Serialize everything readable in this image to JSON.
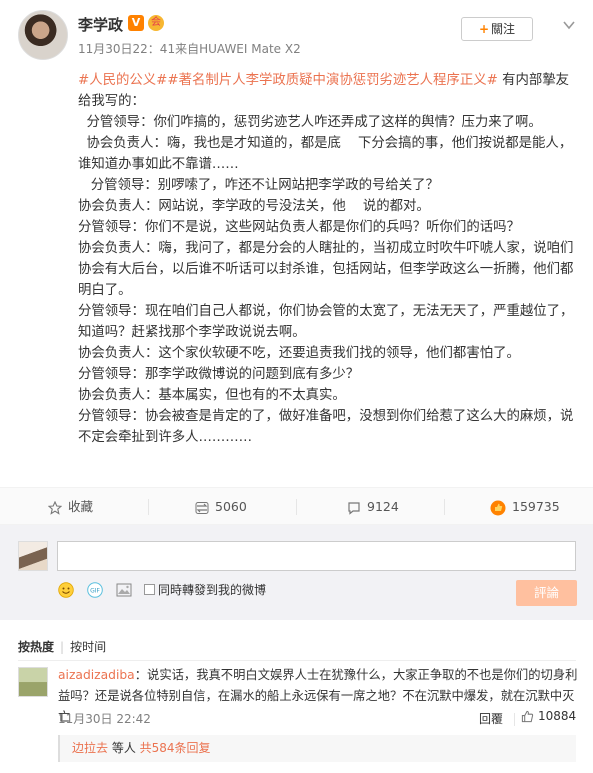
{
  "author": {
    "name": "李学政",
    "verified_badge": "V",
    "member_badge": "会",
    "meta": "11月30日22：41来自HUAWEI Mate X2"
  },
  "follow_button": {
    "plus": "+",
    "label": "關注"
  },
  "post": {
    "topics": [
      "#人民的公义#",
      "#著名制片人李学政质疑中演协惩罚劣迹艺人程序正义#"
    ],
    "intro": " 有内部摯友给我写的：",
    "lines": [
      "  分管领导：你们咋搞的，惩罚劣迹艺人咋还弄成了这样的舆情？压力来了啊。",
      "  协会负责人：嗨，我也是才知道的，都是底    下分会搞的事，他们按说都是能人，谁知道办事如此不靠谱……",
      "   分管领导：别啰嗦了，咋还不让网站把李学政的号给关了？",
      "协会负责人：网站说，李学政的号没法关，他    说的都对。",
      "分管领导：你们不是说，这些网站负责人都是你们的兵吗？听你们的话吗？",
      "协会负责人：嗨，我问了，都是分会的人瞎扯的，当初成立时吹牛吓唬人家，说咱们协会有大后台，以后谁不听话可以封杀谁，包括网站，但李学政这么一折腾，他们都明白了。",
      "分管领导：现在咱们自己人都说，你们协会管的太宽了，无法无天了，严重越位了，知道吗？赶紧找那个李学政说说去啊。",
      "协会负责人：这个家伙软硬不吃，还要追责我们找的领导，他们都害怕了。",
      "分管领导：那李学政微博说的问题到底有多少？",
      "协会负责人：基本属实，但也有的不太真实。",
      "分管领导：协会被查是肯定的了，做好准备吧，没想到你们给惹了这么大的麻烦，说不定会牵扯到许多人…………"
    ]
  },
  "actions": {
    "favorite": "收藏",
    "repost": "5060",
    "comment": "9124",
    "like": "159735"
  },
  "composer": {
    "input_value": "",
    "repost_label": "同時轉發到我的微博",
    "submit": "評論"
  },
  "sort": {
    "hot": "按热度",
    "time": "按时间"
  },
  "comment": {
    "user": "aizadizadiba",
    "text": "：说实话，我真不明白文娱界人士在犹豫什么，大家正争取的不也是你们的切身利益吗？还是说各位特别自信，在漏水的船上永远保有一席之地？不在沉默中爆发，就在沉默中灭亡",
    "time": "11月30日 22:42",
    "reply": "回覆",
    "likes": "10884"
  },
  "subreply": {
    "user": "边拉去",
    "middle": " 等人 ",
    "count_link": "共584条回复"
  },
  "colors": {
    "accent": "#eb7350",
    "brand_orange": "#ff8200",
    "submit_disabled": "#ffc09f"
  },
  "icons": [
    "chevron-down-icon",
    "star-icon",
    "repost-icon",
    "comment-icon",
    "thumb-up-icon",
    "emoji-icon",
    "gif-icon",
    "image-icon"
  ]
}
